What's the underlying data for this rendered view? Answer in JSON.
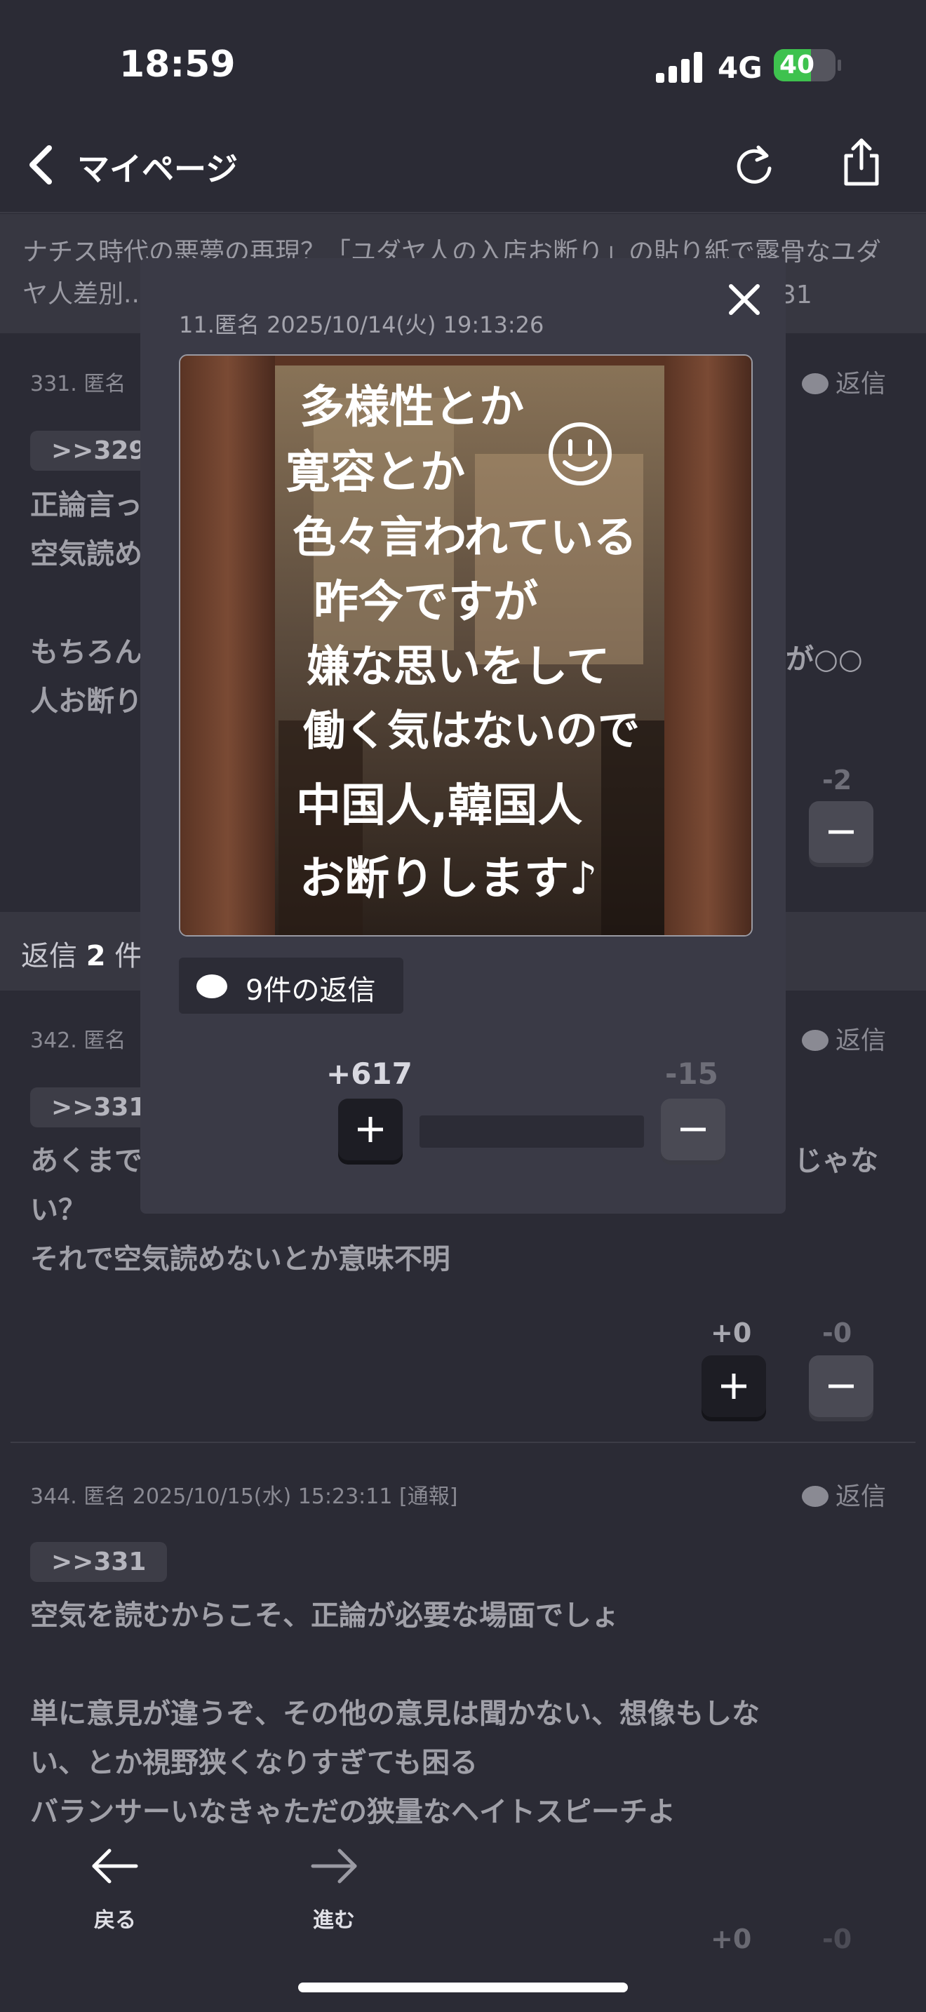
{
  "status_bar": {
    "time": "18:59",
    "network": "4G",
    "battery": "40"
  },
  "header": {
    "title": "マイページ",
    "reload_icon": "reload-icon",
    "share_icon": "share-icon"
  },
  "thread": {
    "title_line1": "ナチス時代の悪夢の再現？「ユダヤ人の入店お断り」の貼り紙で露骨なユダ",
    "title_line2": "ヤ人差別...",
    "title_count": "31"
  },
  "posts": [
    {
      "meta": "331. 匿名",
      "reply": "返信",
      "anchor": ">>329",
      "line1": "正論言っ",
      "line2": "空気読め",
      "line3": "もちろん",
      "line3_right": "が○○",
      "line4": "人お断り",
      "minus_score": "-2"
    },
    {
      "meta": "342. 匿名",
      "reply": "返信",
      "anchor": ">>331",
      "line1": "あくまで",
      "line1_right": "じゃな",
      "line2": "い？",
      "line3": "それで空気読めないとか意味不明",
      "plus_score": "+0",
      "minus_score": "-0"
    },
    {
      "meta": "344. 匿名 2025/10/15(水) 15:23:11 [通報]",
      "reply": "返信",
      "anchor": ">>331",
      "line1": "空気を読むからこそ、正論が必要な場面でしょ",
      "line2": "単に意見が違うぞ、その他の意見は聞かない、想像もしな",
      "line3": "い、とか視野狭くなりすぎても困る",
      "line4": "バランサーいなきゃただの狭量なヘイトスピーチよ",
      "plus_score": "+0",
      "minus_score": "-0"
    }
  ],
  "replies_band": {
    "prefix": "返信 ",
    "count": "2",
    "suffix": " 件"
  },
  "modal": {
    "meta": "11.匿名 2025/10/14(火) 19:13:26",
    "image_text": [
      "多様性とか",
      "寛容とか",
      "色々言われている",
      "昨今ですが",
      "嫌な思いをして",
      "働く気はないので",
      "中国人,韓国人",
      "お断りします♪"
    ],
    "replies_label": "9件の返信",
    "plus_score": "+617",
    "minus_score": "-15"
  },
  "toolbar": {
    "back_label": "戻る",
    "forward_label": "進む"
  }
}
